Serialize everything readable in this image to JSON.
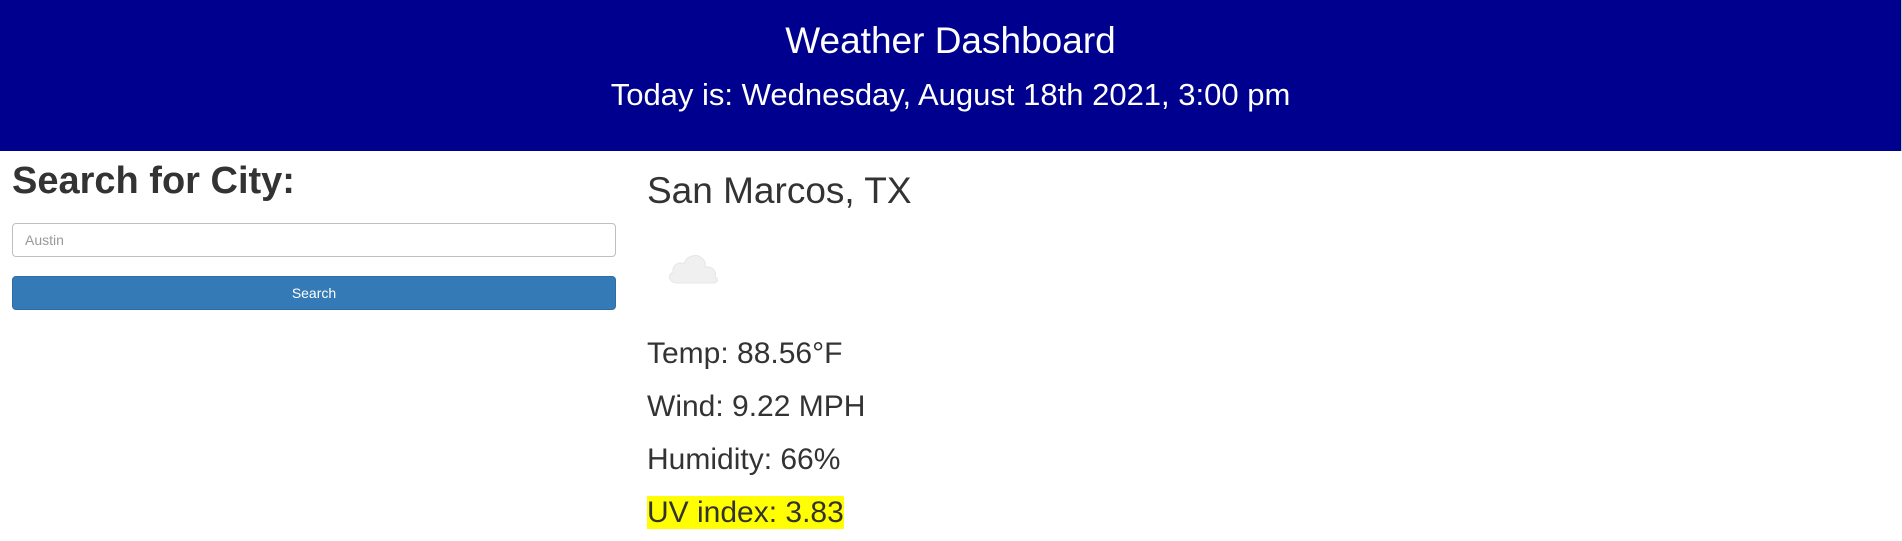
{
  "header": {
    "title": "Weather Dashboard",
    "today": "Today is: Wednesday, August 18th 2021, 3:00 pm"
  },
  "search": {
    "heading": "Search for City:",
    "placeholder": "Austin",
    "value": "",
    "button_label": "Search"
  },
  "current": {
    "city": "San Marcos, TX",
    "icon": "cloud-icon",
    "temp": "Temp: 88.56°F",
    "wind": "Wind: 9.22 MPH",
    "humidity": "Humidity: 66%",
    "uv": "UV index: 3.83",
    "uv_color": "#ffff00"
  },
  "colors": {
    "header_bg": "#00008f",
    "button_bg": "#337ab7"
  }
}
